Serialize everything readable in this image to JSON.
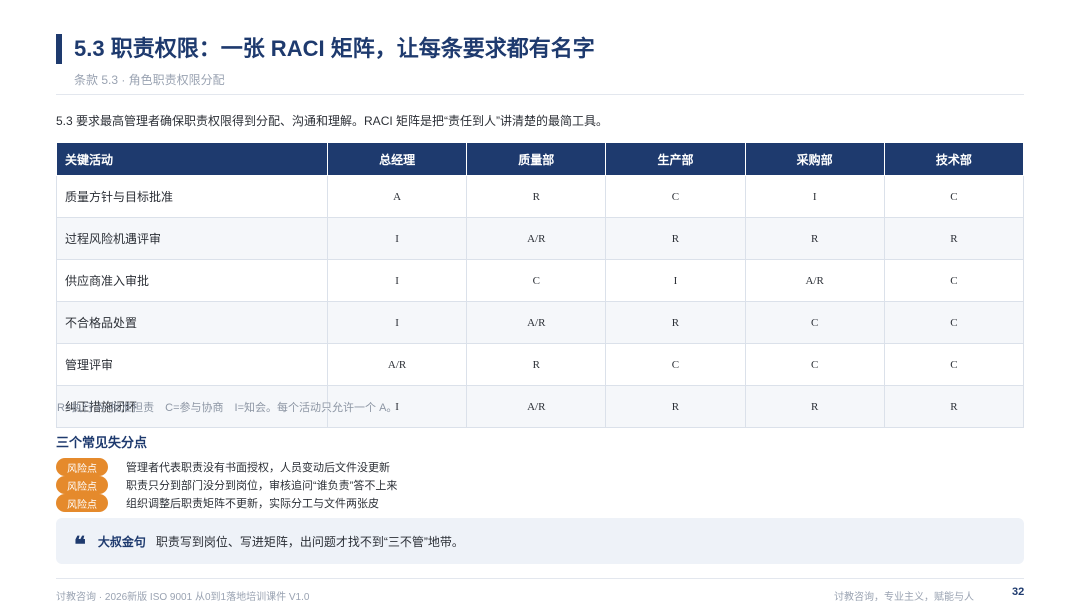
{
  "header": {
    "title": "5.3 职责权限：一张 RACI 矩阵，让每条要求都有名字",
    "subtitle": "条款 5.3 · 角色职责权限分配"
  },
  "intro": "5.3 要求最高管理者确保职责权限得到分配、沟通和理解。RACI 矩阵是把“责任到人”讲清楚的最简工具。",
  "table": {
    "headers": [
      "关键活动",
      "总经理",
      "质量部",
      "生产部",
      "采购部",
      "技术部"
    ],
    "rows": [
      [
        "质量方针与目标批准",
        "A",
        "R",
        "C",
        "I",
        "C"
      ],
      [
        "过程风险机遇评审",
        "I",
        "A/R",
        "R",
        "R",
        "R"
      ],
      [
        "供应商准入审批",
        "I",
        "C",
        "I",
        "A/R",
        "C"
      ],
      [
        "不合格品处置",
        "I",
        "A/R",
        "R",
        "C",
        "C"
      ],
      [
        "管理评审",
        "A/R",
        "R",
        "C",
        "C",
        "C"
      ],
      [
        "纠正措施闭环",
        "I",
        "A/R",
        "R",
        "R",
        "R"
      ]
    ]
  },
  "legend": "R=执行 A=批准担责　C=参与协商　I=知会。每个活动只允许一个 A。",
  "pitfalls": {
    "heading": "三个常见失分点",
    "badge": "风险点",
    "items": [
      "管理者代表职责没有书面授权，人员变动后文件没更新",
      "职责只分到部门没分到岗位，审核追问“谁负责”答不上来",
      "组织调整后职责矩阵不更新，实际分工与文件两张皮"
    ]
  },
  "quote": {
    "icon": "quote-icon",
    "label": "大叔金句",
    "text": "职责写到岗位、写进矩阵，出问题才找不到“三不管”地带。"
  },
  "footer": {
    "left": "讨教咨询 · 2026新版 ISO 9001 从0到1落地培训课件 V1.0",
    "right": "讨教咨询，专业主义，赋能与人",
    "page": "32"
  },
  "colors": {
    "primary": "#1e3a6e",
    "accent": "#e58a2c"
  }
}
